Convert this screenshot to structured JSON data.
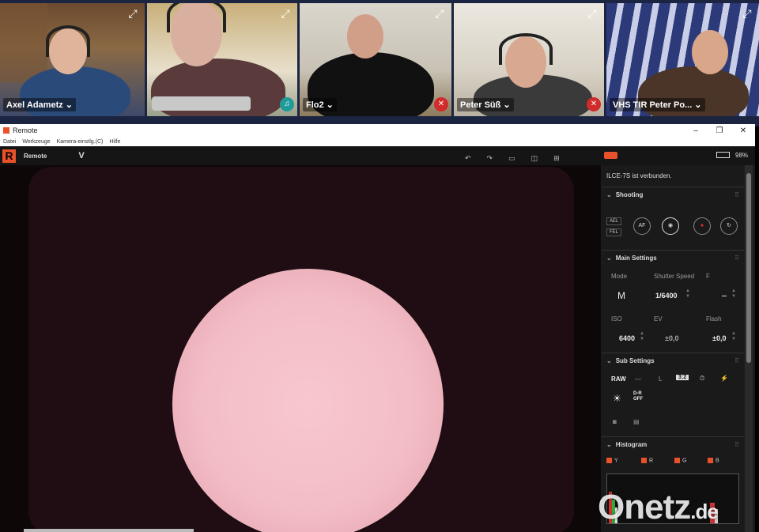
{
  "participants": [
    {
      "name": "Axel Adametz",
      "mic": "none"
    },
    {
      "name": "",
      "mic": "on"
    },
    {
      "name": "Flo2",
      "mic": "muted"
    },
    {
      "name": "Peter Süß",
      "mic": "muted"
    },
    {
      "name": "VHS TIR Peter Po...",
      "mic": "none"
    }
  ],
  "window": {
    "title": "Remote"
  },
  "menu": [
    "Datei",
    "Werkzeuge",
    "Kamera-einstlg.(C)",
    "Hilfe"
  ],
  "toolbar": {
    "app_name": "Remote",
    "mode_icon": "V",
    "battery": "98%"
  },
  "panel": {
    "status": "ILCE-7S ist verbunden.",
    "shooting": {
      "title": "Shooting",
      "ael": "AEL",
      "fel": "FEL",
      "af": "AF"
    },
    "main": {
      "title": "Main Settings",
      "mode_label": "Mode",
      "mode_value": "M",
      "shutter_label": "Shutter Speed",
      "shutter_value": "1/6400",
      "f_label": "F",
      "f_value": "--",
      "iso_label": "ISO",
      "iso_value": "6400",
      "ev_label": "EV",
      "ev_value": "±0,0",
      "flash_label": "Flash",
      "flash_value": "±0,0"
    },
    "sub": {
      "title": "Sub Settings",
      "raw": "RAW",
      "l": "L",
      "ratio": "3:2",
      "dro": "D-R OFF"
    },
    "histogram": {
      "title": "Histogram",
      "channels": [
        "Y",
        "R",
        "G",
        "B"
      ]
    }
  },
  "watermark": {
    "brand": "Onetz",
    "tld": ".de"
  },
  "colors": {
    "accent": "#e8512a",
    "sun": "#f3bdc7",
    "mute": "#d12b2b"
  }
}
